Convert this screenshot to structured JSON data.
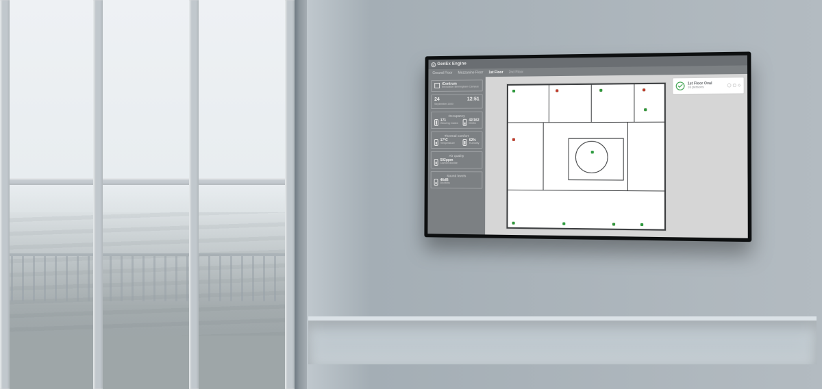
{
  "brand": {
    "name": "GenEx Engine"
  },
  "tabs": [
    {
      "label": "Ground Floor",
      "active": false
    },
    {
      "label": "Mezzanine Floor",
      "active": false
    },
    {
      "label": "1st Floor",
      "active": true
    },
    {
      "label": "2nd Floor",
      "active": false
    }
  ],
  "location": {
    "name": "iCentrum",
    "subline": "Innovation Birmingham Campus"
  },
  "datetime": {
    "day": "24",
    "month_year": "September 2020",
    "time": "12:51"
  },
  "sections": {
    "occupancy": {
      "title": "Occupancy",
      "left_value": "171",
      "left_label": "Wearing masks",
      "right_value": "42/162",
      "right_label": "Desks"
    },
    "thermal": {
      "title": "Thermal comfort",
      "left_value": "17°C",
      "left_label": "Temperature",
      "right_value": "62%",
      "right_label": "Humidity"
    },
    "air": {
      "title": "Air quality",
      "value": "502ppm",
      "label": "Carbon dioxide"
    },
    "sound": {
      "title": "Sound levels",
      "value": "46dB",
      "label": "Decibels"
    }
  },
  "selected_zone": {
    "name": "1st Floor Oval",
    "persons": "16 persons"
  },
  "colors": {
    "ok": "#2c9a3e",
    "bad": "#c23a2f",
    "panel": "#7c8083"
  }
}
